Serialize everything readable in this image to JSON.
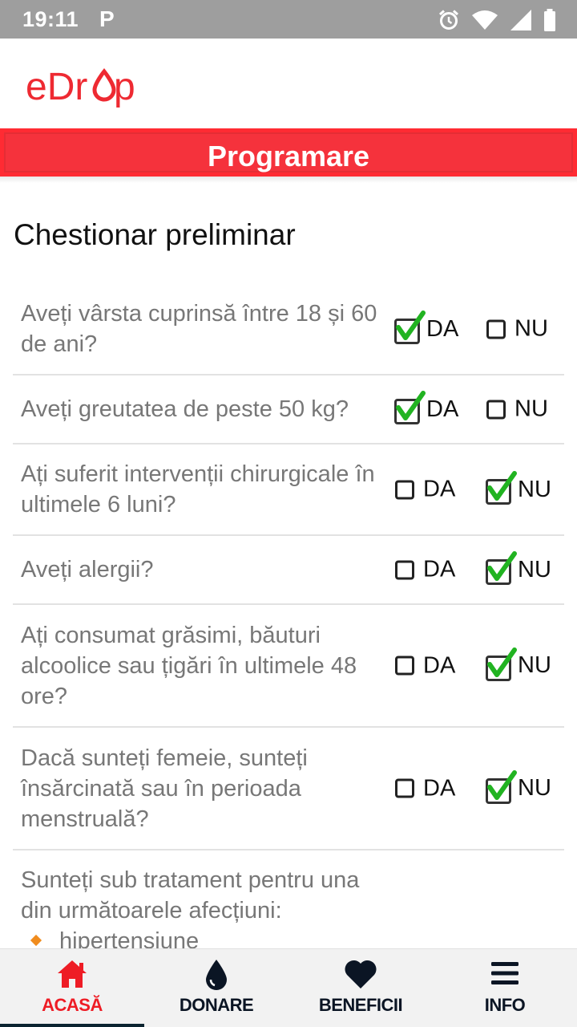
{
  "status_bar": {
    "time": "19:11",
    "notification_glyph": "P",
    "icons": [
      "alarm-icon",
      "wifi-icon",
      "signal-icon",
      "battery-icon"
    ]
  },
  "header": {
    "logo_text": "eDrop",
    "brand_color": "#ee2a32"
  },
  "title_banner": {
    "label": "Programare",
    "color": "#f5323c"
  },
  "section": {
    "title": "Chestionar preliminar"
  },
  "options": {
    "yes_label": "DA",
    "no_label": "NU"
  },
  "questions": [
    {
      "text": "Aveți vârsta cuprinsă între 18 și 60 de ani?",
      "answer": "DA"
    },
    {
      "text": "Aveți greutatea de peste 50 kg?",
      "answer": "DA"
    },
    {
      "text": "Ați suferit intervenții chirurgicale în ultimele 6 luni?",
      "answer": "NU"
    },
    {
      "text": "Aveți alergii?",
      "answer": "NU"
    },
    {
      "text": "Ați consumat grăsimi, băuturi alcoolice sau țigări în ultimele 48 ore?",
      "answer": "NU"
    },
    {
      "text": "Dacă sunteți femeie, sunteți însărcinată sau în perioada menstruală?",
      "answer": "NU"
    }
  ],
  "trailing_question": {
    "text": "Sunteți sub tratament pentru una din următoarele afecțiuni:",
    "bullets": [
      "hipertensiune"
    ]
  },
  "bottom_nav": {
    "items": [
      {
        "label": "ACASĂ",
        "icon": "home-icon",
        "active": true
      },
      {
        "label": "DONARE",
        "icon": "drop-icon",
        "active": false
      },
      {
        "label": "BENEFICII",
        "icon": "heart-icon",
        "active": false
      },
      {
        "label": "INFO",
        "icon": "menu-icon",
        "active": false
      }
    ]
  },
  "colors": {
    "check_green": "#21b321",
    "active_nav": "#ee1c25"
  }
}
